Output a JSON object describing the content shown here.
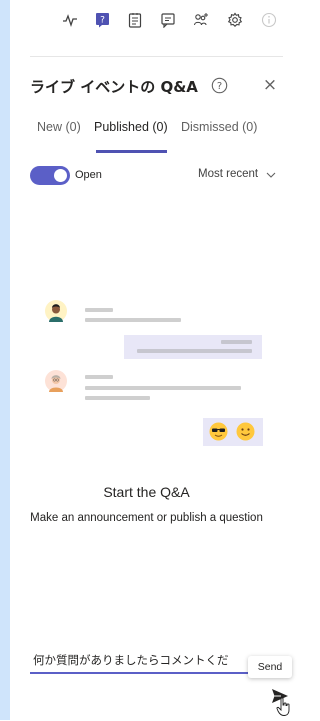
{
  "panel": {
    "title": "ライブ イベントの Q&A",
    "close_label": "×"
  },
  "toolbar": {
    "icons": [
      "activity-icon",
      "qa-icon",
      "notes-icon",
      "chat-icon",
      "people-add-icon",
      "settings-icon",
      "info-icon"
    ]
  },
  "tabs": [
    {
      "label": "New (0)",
      "active": false
    },
    {
      "label": "Published (0)",
      "active": true
    },
    {
      "label": "Dismissed (0)",
      "active": false
    }
  ],
  "toggle": {
    "label": "Open",
    "on": true
  },
  "sort": {
    "selected": "Most recent"
  },
  "empty_state": {
    "title": "Start the Q&A",
    "subtitle": "Make an announcement or publish a question"
  },
  "compose": {
    "value": "何か質問がありましたらコメントくだ",
    "placeholder": ""
  },
  "send": {
    "tooltip": "Send"
  },
  "colors": {
    "accent": "#5b5fc7",
    "side_strip": "#cfe4fb",
    "bubble": "#e8e7f7"
  }
}
